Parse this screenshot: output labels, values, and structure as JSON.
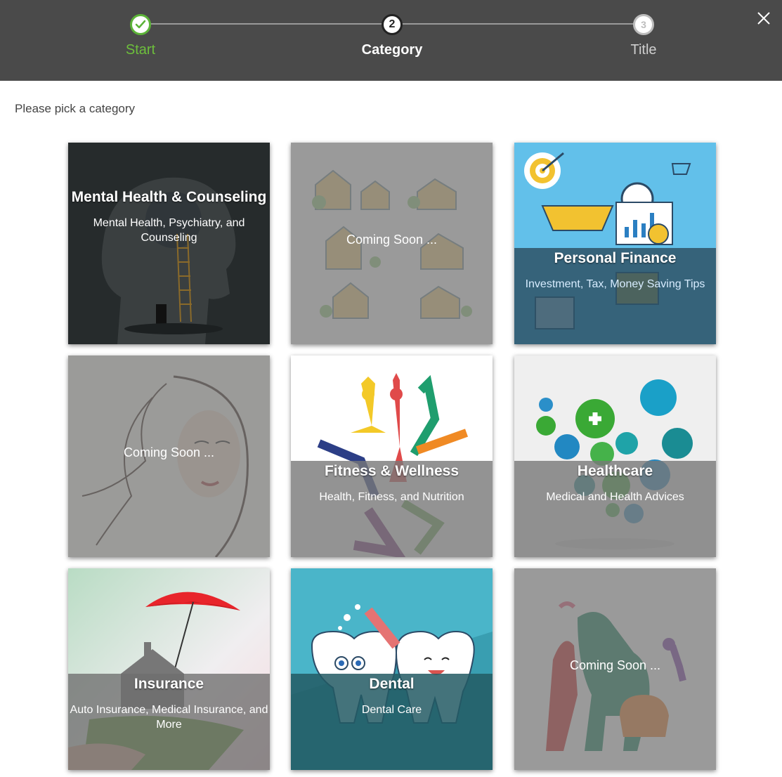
{
  "stepper": {
    "steps": [
      {
        "label": "Start",
        "state": "completed",
        "icon": "check-icon"
      },
      {
        "label": "Category",
        "number": "2",
        "state": "active"
      },
      {
        "label": "Title",
        "number": "3",
        "state": "upcoming"
      }
    ],
    "close_icon": "close-icon"
  },
  "prompt": "Please pick a category",
  "tiles": [
    {
      "title": "Mental Health & Counseling",
      "subtitle": "Mental Health, Psychiatry, and Counseling"
    },
    {
      "status": "Coming Soon ..."
    },
    {
      "title": "Personal Finance",
      "subtitle": "Investment, Tax, Money Saving Tips"
    },
    {
      "status": "Coming Soon ..."
    },
    {
      "title": "Fitness & Wellness",
      "subtitle": "Health, Fitness, and Nutrition"
    },
    {
      "title": "Healthcare",
      "subtitle": "Medical and Health Advices"
    },
    {
      "title": "Insurance",
      "subtitle": "Auto Insurance, Medical Insurance, and More"
    },
    {
      "title": "Dental",
      "subtitle": "Dental Care"
    },
    {
      "status": "Coming Soon ..."
    }
  ],
  "colors": {
    "header_bg": "#4a4a4a",
    "completed_green": "#6dbf3c",
    "finance_sky": "#5bbde6",
    "dental_teal": "#45b3c7"
  }
}
